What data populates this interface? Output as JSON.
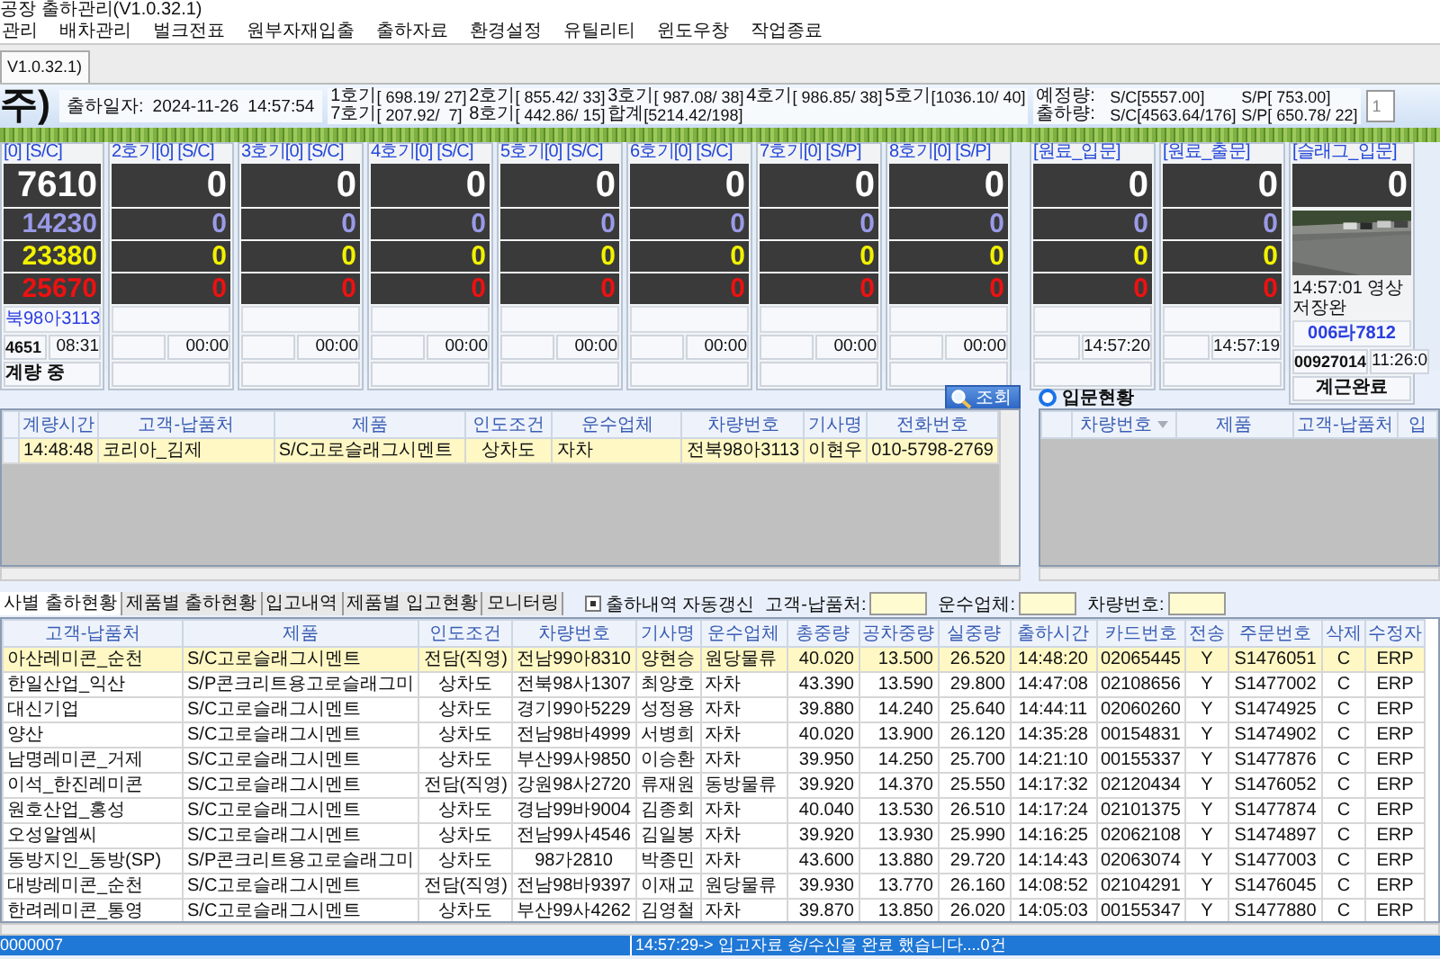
{
  "window": {
    "title": "공장 출하관리(V1.0.32.1)"
  },
  "menu": [
    "관리",
    "배차관리",
    "벌크전표",
    "원부자재입출",
    "출하자료",
    "환경설정",
    "유틸리티",
    "윈도우창",
    "작업종료"
  ],
  "doc_tabs": [
    {
      "label": "V1.0.32.1)",
      "selected": true
    }
  ],
  "header": {
    "company": "주)",
    "date_label": "출하일자:",
    "date": "2024-11-26",
    "time": "14:57:54",
    "totals": [
      {
        "label": "1호기",
        "value": "[ 698.19/ 27]"
      },
      {
        "label": "2호기",
        "value": "[ 855.42/ 33]"
      },
      {
        "label": "3호기",
        "value": "[ 987.08/ 38]"
      },
      {
        "label": "4호기",
        "value": "[ 986.85/ 38]"
      },
      {
        "label": "5호기",
        "value": "[1036.10/ 40]"
      },
      {
        "label": "7호기",
        "value": "[ 207.92/  7]"
      },
      {
        "label": "8호기",
        "value": "[ 442.86/ 15]"
      },
      {
        "label": "합계",
        "value": "[5214.42/198]"
      }
    ],
    "plan": [
      {
        "label": "예정량:",
        "sc": "S/C[5557.00]",
        "sp": "S/P[ 753.00]"
      },
      {
        "label": "출하량:",
        "sc": "S/C[4563.64/176]",
        "sp": "S/P[ 650.78/ 22]"
      }
    ],
    "field": "1"
  },
  "panels": [
    {
      "title": "[0] [S/C]",
      "kind": "scale",
      "values": [
        "7610",
        "14230",
        "23380",
        "25670"
      ],
      "plate": "북98아3113",
      "code": "4651",
      "time": "08:31",
      "status": "계량 중"
    },
    {
      "title": "2호기[0] [S/C]",
      "kind": "scale",
      "values": [
        "0",
        "0",
        "0",
        "0"
      ],
      "time": "00:00"
    },
    {
      "title": "3호기[0] [S/C]",
      "kind": "scale",
      "values": [
        "0",
        "0",
        "0",
        "0"
      ],
      "time": "00:00"
    },
    {
      "title": "4호기[0] [S/C]",
      "kind": "scale",
      "values": [
        "0",
        "0",
        "0",
        "0"
      ],
      "time": "00:00"
    },
    {
      "title": "5호기[0] [S/C]",
      "kind": "scale",
      "values": [
        "0",
        "0",
        "0",
        "0"
      ],
      "time": "00:00"
    },
    {
      "title": "6호기[0] [S/C]",
      "kind": "scale",
      "values": [
        "0",
        "0",
        "0",
        "0"
      ],
      "time": "00:00"
    },
    {
      "title": "7호기[0] [S/P]",
      "kind": "scale",
      "values": [
        "0",
        "0",
        "0",
        "0"
      ],
      "time": "00:00"
    },
    {
      "title": "8호기[0] [S/P]",
      "kind": "scale",
      "values": [
        "0",
        "0",
        "0",
        "0"
      ],
      "time": "00:00"
    },
    {
      "title": "[원료_입문]",
      "kind": "scale",
      "values": [
        "0",
        "0",
        "0",
        "0"
      ],
      "time": "14:57:20"
    },
    {
      "title": "[원료_출문]",
      "kind": "scale",
      "values": [
        "0",
        "0",
        "0",
        "0"
      ],
      "time": "14:57:19"
    },
    {
      "title": "[슬래그_입문]",
      "kind": "camera",
      "values": [
        "0"
      ],
      "caption": "14:57:01 영상저장완",
      "plate": "006라7812",
      "code": "00927014",
      "time": "11:26:0",
      "status": "계근완료"
    }
  ],
  "search_button": "조회",
  "orders": {
    "columns": [
      "계량시간",
      "고객-납품처",
      "제품",
      "인도조건",
      "운수업체",
      "차량번호",
      "기사명",
      "전화번호"
    ],
    "rows": [
      {
        "selected": true,
        "cells": [
          "14:48:48",
          "코리아_김제",
          "S/C고로슬래그시멘트",
          "상차도",
          "자차",
          "전북98아3113",
          "이현우",
          "010-5798-2769"
        ]
      }
    ]
  },
  "entry": {
    "title": "입문현황",
    "selected": true,
    "columns": [
      "차량번호",
      "제품",
      "고객-납품처",
      "입"
    ]
  },
  "report_tabs": [
    {
      "label": "사별 출하현황",
      "selected": true
    },
    {
      "label": "제품별 출하현황",
      "selected": false
    },
    {
      "label": "입고내역",
      "selected": false
    },
    {
      "label": "제품별 입고현황",
      "selected": false
    },
    {
      "label": "모니터링",
      "selected": false
    }
  ],
  "auto_refresh": {
    "label": "출하내역 자동갱신",
    "checked": true
  },
  "filters": [
    {
      "label": "고객-납품처:"
    },
    {
      "label": "운수업체:"
    },
    {
      "label": "차량번호:"
    }
  ],
  "shipments": {
    "columns": [
      "고객-납품처",
      "제품",
      "인도조건",
      "차량번호",
      "기사명",
      "운수업체",
      "총중량",
      "공차중량",
      "실중량",
      "출하시간",
      "카드번호",
      "전송",
      "주문번호",
      "삭제",
      "수정자"
    ],
    "rows": [
      {
        "selected": true,
        "cells": [
          "아산레미콘_순천",
          "S/C고로슬래그시멘트",
          "전담(직영)",
          "전남99아8310",
          "양현승",
          "원당물류",
          "40.020",
          "13.500",
          "26.520",
          "14:48:20",
          "02065445",
          "Y",
          "S1476051",
          "C",
          "ERP"
        ]
      },
      {
        "selected": false,
        "cells": [
          "한일산업_익산",
          "S/P콘크리트용고로슬래그미",
          "상차도",
          "전북98사1307",
          "최양호",
          "자차",
          "43.390",
          "13.590",
          "29.800",
          "14:47:08",
          "02108656",
          "Y",
          "S1477002",
          "C",
          "ERP"
        ]
      },
      {
        "selected": false,
        "cells": [
          "대신기업",
          "S/C고로슬래그시멘트",
          "상차도",
          "경기99아5229",
          "성정용",
          "자차",
          "39.880",
          "14.240",
          "25.640",
          "14:44:11",
          "02060260",
          "Y",
          "S1474925",
          "C",
          "ERP"
        ]
      },
      {
        "selected": false,
        "cells": [
          "양산",
          "S/C고로슬래그시멘트",
          "상차도",
          "전남98바4999",
          "서병희",
          "자차",
          "40.020",
          "13.900",
          "26.120",
          "14:35:28",
          "00154831",
          "Y",
          "S1474902",
          "C",
          "ERP"
        ]
      },
      {
        "selected": false,
        "cells": [
          "남명레미콘_거제",
          "S/C고로슬래그시멘트",
          "상차도",
          "부산99사9850",
          "이승환",
          "자차",
          "39.950",
          "14.250",
          "25.700",
          "14:21:10",
          "00155337",
          "Y",
          "S1477876",
          "C",
          "ERP"
        ]
      },
      {
        "selected": false,
        "cells": [
          "이석_한진레미콘",
          "S/C고로슬래그시멘트",
          "전담(직영)",
          "강원98사2720",
          "류재원",
          "동방물류",
          "39.920",
          "14.370",
          "25.550",
          "14:17:32",
          "02120434",
          "Y",
          "S1476052",
          "C",
          "ERP"
        ]
      },
      {
        "selected": false,
        "cells": [
          "원호산업_홍성",
          "S/C고로슬래그시멘트",
          "상차도",
          "경남99바9004",
          "김종회",
          "자차",
          "40.040",
          "13.530",
          "26.510",
          "14:17:24",
          "02101375",
          "Y",
          "S1477874",
          "C",
          "ERP"
        ]
      },
      {
        "selected": false,
        "cells": [
          "오성알엠씨",
          "S/C고로슬래그시멘트",
          "상차도",
          "전남99사4546",
          "김일봉",
          "자차",
          "39.920",
          "13.930",
          "25.990",
          "14:16:25",
          "02062108",
          "Y",
          "S1474897",
          "C",
          "ERP"
        ]
      },
      {
        "selected": false,
        "cells": [
          "동방지인_동방(SP)",
          "S/P콘크리트용고로슬래그미",
          "상차도",
          "98가2810",
          "박종민",
          "자차",
          "43.600",
          "13.880",
          "29.720",
          "14:14:43",
          "02063074",
          "Y",
          "S1477003",
          "C",
          "ERP"
        ]
      },
      {
        "selected": false,
        "cells": [
          "대방레미콘_순천",
          "S/C고로슬래그시멘트",
          "전담(직영)",
          "전남98바9397",
          "이재교",
          "원당물류",
          "39.930",
          "13.770",
          "26.160",
          "14:08:52",
          "02104291",
          "Y",
          "S1476045",
          "C",
          "ERP"
        ]
      },
      {
        "selected": false,
        "cells": [
          "한려레미콘_통영",
          "S/C고로슬래그시멘트",
          "상차도",
          "부산99사4262",
          "김영철",
          "자차",
          "39.870",
          "13.850",
          "26.020",
          "14:05:03",
          "00155347",
          "Y",
          "S1477880",
          "C",
          "ERP"
        ]
      }
    ]
  },
  "status_bar": [
    "0000007",
    "14:57:29-> 입고자료 송/수신을 완료 했습니다....0건"
  ]
}
